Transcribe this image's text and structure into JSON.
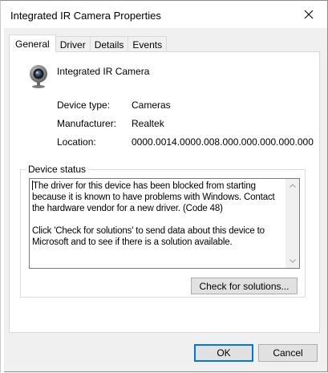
{
  "window": {
    "title": "Integrated IR Camera Properties"
  },
  "tabs": [
    {
      "label": "General",
      "active": true
    },
    {
      "label": "Driver",
      "active": false
    },
    {
      "label": "Details",
      "active": false
    },
    {
      "label": "Events",
      "active": false
    }
  ],
  "device": {
    "name": "Integrated IR Camera",
    "icon": "webcam-icon"
  },
  "properties": [
    {
      "label": "Device type:",
      "value": "Cameras"
    },
    {
      "label": "Manufacturer:",
      "value": "Realtek"
    },
    {
      "label": "Location:",
      "value": "0000.0014.0000.008.000.000.000.000.000"
    }
  ],
  "status": {
    "legend": "Device status",
    "paragraph1": "The driver for this device has been blocked from starting because it is known to have problems with Windows. Contact the hardware vendor for a new driver. (Code 48)",
    "paragraph2": "Click 'Check for solutions' to send data about this device to Microsoft and to see if there is a solution available.",
    "check_button": "Check for solutions..."
  },
  "footer": {
    "ok_label": "OK",
    "cancel_label": "Cancel"
  },
  "colors": {
    "accent": "#0078d7",
    "dialog_bg": "#f0f0f0",
    "button_bg": "#e1e1e1"
  }
}
